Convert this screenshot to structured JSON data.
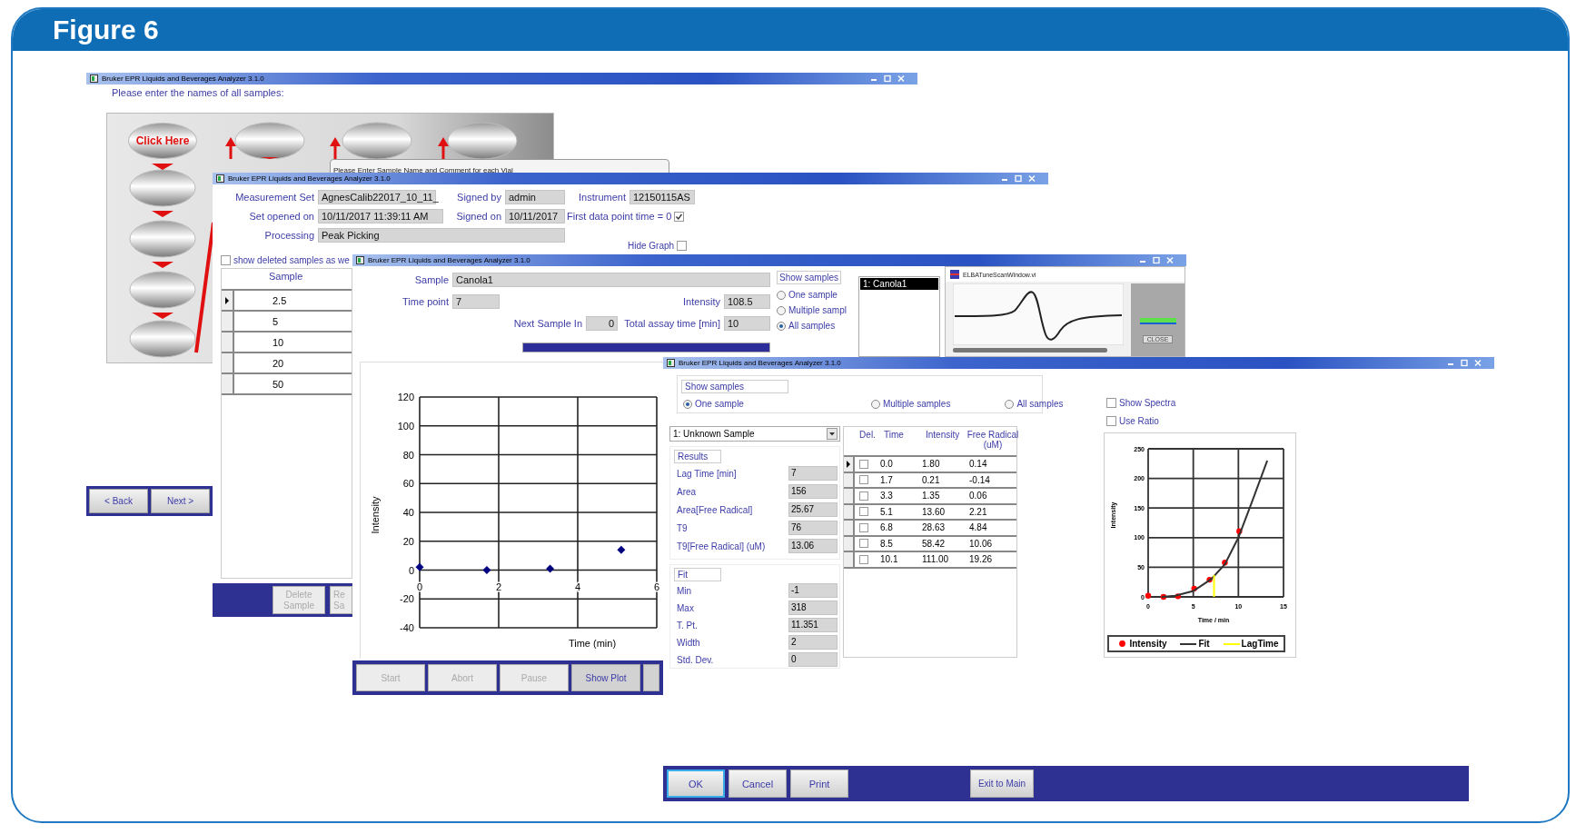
{
  "figure": {
    "title": "Figure 6"
  },
  "sample_entry_window": {
    "title": "Bruker EPR Liquids and Beverages Analyzer 3.1.0",
    "instruction": "Please enter the names of all samples:",
    "vial_button": "Click Here",
    "dialog_title": "Please Enter Sample Name and Comment for each Vial",
    "nav_buttons": [
      "< Back",
      "Next >"
    ]
  },
  "measurement_window": {
    "title": "Bruker EPR Liquids and Beverages Analyzer 3.1.0",
    "field_rows": [
      {
        "fields": [
          {
            "label": "Measurement Set",
            "value": "AgnesCalib22017_10_11_"
          },
          {
            "label": "Signed by",
            "value": "admin"
          },
          {
            "label": "Instrument",
            "value": "12150115AS"
          }
        ]
      },
      {
        "fields": [
          {
            "label": "Set opened on",
            "value": "10/11/2017 11:39:11 AM"
          },
          {
            "label": "Signed on",
            "value": "10/11/2017"
          }
        ]
      },
      {
        "fields": [
          {
            "label": "Processing",
            "value": "Peak Picking"
          }
        ]
      }
    ],
    "first_point": {
      "label": "First data point time = 0",
      "checked": true
    },
    "hide_graph": {
      "label": "Hide Graph",
      "checked": false
    },
    "show_deleted": {
      "label": "show deleted samples as we",
      "checked": false
    },
    "table": {
      "columns": [
        "Sample"
      ],
      "rows": [
        {
          "cells": [
            "2.5"
          ],
          "selected": true
        },
        {
          "cells": [
            "5"
          ],
          "selected": false
        },
        {
          "cells": [
            "10"
          ],
          "selected": false
        },
        {
          "cells": [
            "20"
          ],
          "selected": false
        },
        {
          "cells": [
            "50"
          ],
          "selected": false
        }
      ]
    },
    "buttons": [
      "Delete Sample",
      "Re Sa"
    ]
  },
  "acquisition_window": {
    "title": "Bruker EPR Liquids and Beverages Analyzer 3.1.0",
    "field_rows": [
      {
        "fields": [
          {
            "label": "Sample",
            "value": "Canola1"
          }
        ]
      },
      {
        "fields": [
          {
            "label": "Time point",
            "value": "7"
          },
          {
            "label": "Intensity",
            "value": "108.5"
          }
        ]
      },
      {
        "fields": [
          {
            "label": "Next Sample In",
            "value": "0"
          },
          {
            "label": "Total assay time [min]",
            "value": "10"
          }
        ]
      }
    ],
    "progress": {
      "level": 1
    },
    "show_samples": {
      "legend": "Show samples",
      "options": [
        {
          "label": "One sample",
          "selected": false
        },
        {
          "label": "Multiple sampl",
          "selected": false
        },
        {
          "label": "All samples",
          "selected": true
        }
      ]
    },
    "sample_list": [
      {
        "label": "1: Canola1",
        "selected": true
      }
    ],
    "scan_window": {
      "title": "ELBATuneScanWindow.vi",
      "close_button": "CLOSE"
    },
    "chart": {
      "chart_data": {
        "type": "scatter",
        "grid": true,
        "xlabel": "Time (min)",
        "ylabel": "Intensity",
        "xlim": [
          0,
          6
        ],
        "ylim": [
          -40,
          120
        ],
        "xticks": [
          0,
          2,
          4,
          6
        ],
        "yticks": [
          -40,
          -20,
          0,
          20,
          40,
          60,
          80,
          100,
          120
        ],
        "series": [
          {
            "color": "#000080",
            "x": [
              0,
              1.7,
              3.3,
              5.1
            ],
            "values": [
              2,
              0,
              1,
              14
            ]
          }
        ]
      }
    },
    "buttons": [
      {
        "label": "Start",
        "disabled": true
      },
      {
        "label": "Abort",
        "disabled": true
      },
      {
        "label": "Pause",
        "disabled": true
      },
      {
        "label": "Show Plot",
        "disabled": false
      },
      {
        "disabled": false
      }
    ]
  },
  "results_window": {
    "title": "Bruker EPR Liquids and Beverages Analyzer 3.1.0",
    "show_samples": {
      "legend": "Show samples",
      "options": [
        {
          "label": "One sample",
          "selected": true
        },
        {
          "label": "Multiple samples",
          "selected": false
        },
        {
          "label": "All samples",
          "selected": false
        }
      ]
    },
    "show_spectra": {
      "label": "Show Spectra",
      "checked": false
    },
    "use_ratio": {
      "label": "Use Ratio",
      "checked": false
    },
    "sample_select": "1: Unknown Sample",
    "results": {
      "legend": "Results",
      "rows": [
        {
          "label": "Lag Time  [min]",
          "value": "7"
        },
        {
          "label": "Area",
          "value": "156"
        },
        {
          "label": "Area[Free Radical]",
          "value": "25.67"
        },
        {
          "label": "T9",
          "value": "76"
        },
        {
          "label": "T9[Free Radical] (uM)",
          "value": "13.06"
        }
      ]
    },
    "fit": {
      "legend": "Fit",
      "rows": [
        {
          "label": "Min",
          "value": "-1"
        },
        {
          "label": "Max",
          "value": "318"
        },
        {
          "label": "T. Pt.",
          "value": "11.351"
        },
        {
          "label": "Width",
          "value": "2"
        },
        {
          "label": "Std. Dev.",
          "value": "0"
        }
      ]
    },
    "table": {
      "del_column": "Del.",
      "columns": [
        "Time",
        "Intensity",
        "Free Radical (uM)"
      ],
      "rows": [
        {
          "cells": [
            "0.0",
            "1.80",
            "0.14"
          ],
          "deleted": false,
          "selected": true
        },
        {
          "cells": [
            "1.7",
            "0.21",
            "-0.14"
          ],
          "deleted": false,
          "selected": false
        },
        {
          "cells": [
            "3.3",
            "1.35",
            "0.06"
          ],
          "deleted": false,
          "selected": false
        },
        {
          "cells": [
            "5.1",
            "13.60",
            "2.21"
          ],
          "deleted": false,
          "selected": false
        },
        {
          "cells": [
            "6.8",
            "28.63",
            "4.84"
          ],
          "deleted": false,
          "selected": false
        },
        {
          "cells": [
            "8.5",
            "58.42",
            "10.06"
          ],
          "deleted": false,
          "selected": false
        },
        {
          "cells": [
            "10.1",
            "111.00",
            "19.26"
          ],
          "deleted": false,
          "selected": false
        }
      ]
    },
    "chart": {
      "chart_data": {
        "type": "scatter",
        "grid": true,
        "legend": "bottom",
        "xlabel": "Time / min",
        "ylabel": "Intensity",
        "xlim": [
          0,
          15
        ],
        "ylim": [
          0,
          250
        ],
        "xticks": [
          0,
          5,
          10,
          15
        ],
        "yticks": [
          0,
          50,
          100,
          150,
          200,
          250
        ],
        "series": [
          {
            "name": "Intensity",
            "color": "#ff0000",
            "x": [
              0,
              1.7,
              3.3,
              5.1,
              6.8,
              8.5,
              10.1
            ],
            "values": [
              2,
              0,
              1,
              14,
              29,
              58,
              111
            ]
          },
          {
            "name": "Fit",
            "type": "line",
            "color": "#333333",
            "x": [
              1.5,
              3,
              5,
              7,
              8.5,
              10,
              11.5,
              13.2
            ],
            "values": [
              0,
              2,
              10,
              30,
              55,
              100,
              160,
              230
            ]
          },
          {
            "name": "LagTime",
            "type": "line",
            "color": "#ffff00",
            "x": [
              7.3,
              7.3
            ],
            "values": [
              0,
              37
            ]
          }
        ]
      }
    },
    "buttons": [
      {
        "label": "OK",
        "focused": true
      },
      {
        "label": "Cancel",
        "focused": false
      },
      {
        "label": "Print",
        "focused": false
      },
      {
        "label": "Exit to Main",
        "focused": false
      }
    ]
  }
}
